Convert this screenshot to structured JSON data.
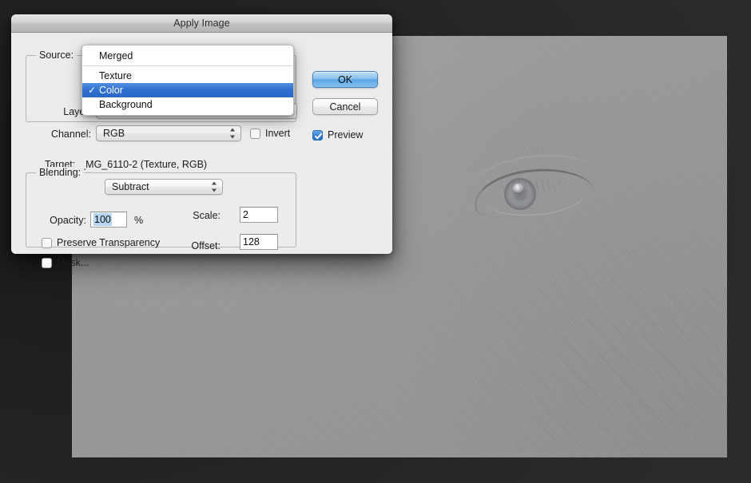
{
  "window": {
    "title": "Apply Image"
  },
  "source_group": {
    "legend": "Source:",
    "layer_label": "Layer:",
    "layer_value": "Color",
    "channel_label": "Channel:",
    "channel_value": "RGB",
    "invert_label": "Invert",
    "invert_checked": false,
    "source_value": "_MG_6110-2"
  },
  "menu": {
    "items": [
      {
        "label": "Merged",
        "checked": false,
        "separator_after": true
      },
      {
        "label": "Texture",
        "checked": false,
        "separator_after": false
      },
      {
        "label": "Color",
        "checked": true,
        "separator_after": false
      },
      {
        "label": "Background",
        "checked": false,
        "separator_after": false
      }
    ],
    "checkmark_glyph": "✓"
  },
  "target": {
    "label": "Target:",
    "value": "_MG_6110-2 (Texture, RGB)"
  },
  "blending_group": {
    "legend": "Blending:",
    "blend_mode": "Subtract",
    "opacity_label": "Opacity:",
    "opacity_value": "100",
    "percent_sign": "%",
    "scale_label": "Scale:",
    "scale_value": "2",
    "offset_label": "Offset:",
    "offset_value": "128",
    "preserve_transparency_label": "Preserve Transparency",
    "preserve_transparency_checked": false,
    "mask_label": "Mask...",
    "mask_checked": false
  },
  "buttons": {
    "ok_label": "OK",
    "cancel_label": "Cancel",
    "preview_label": "Preview",
    "preview_checked": true
  },
  "colors": {
    "dialog_bg": "#ececec",
    "titlebar_top": "#e4e4e4",
    "titlebar_bottom": "#b4b4b4",
    "menu_highlight": "#2f6fd0",
    "default_button": "#5ba6e6",
    "field_selection": "#b5d6f2",
    "desktop_bg": "#262626",
    "canvas_gray": "#9a9a9a"
  }
}
